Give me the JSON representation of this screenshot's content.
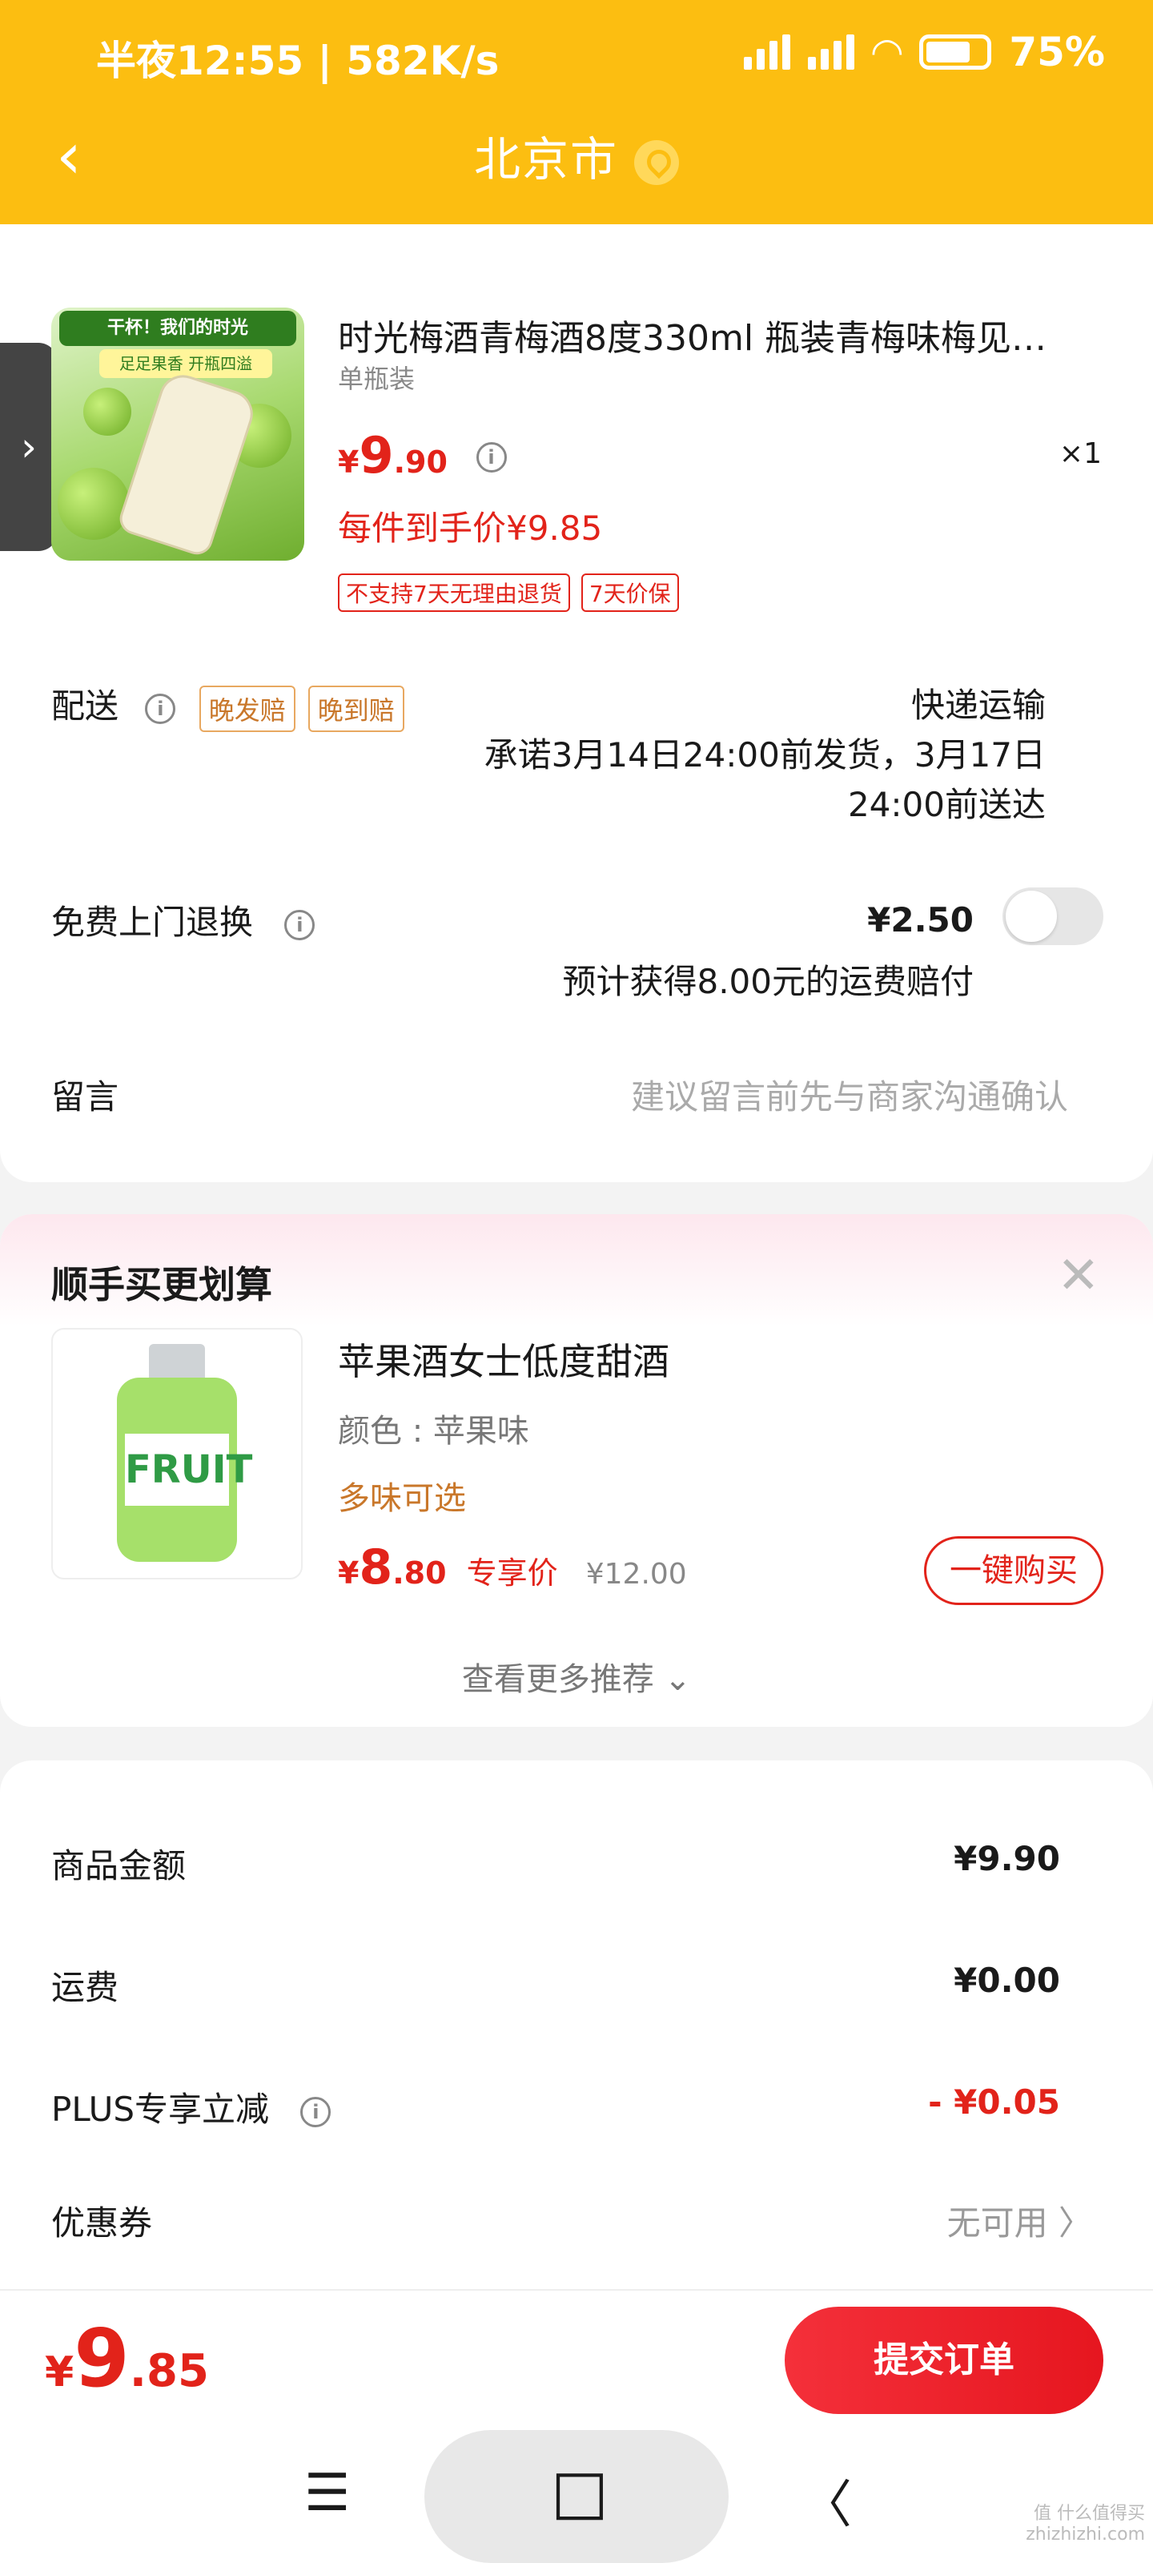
{
  "status_bar": {
    "time": "半夜12:55 | 582K/s",
    "mute_icon": "bell-off-icon",
    "battery": "75%"
  },
  "nav": {
    "back_icon": "chevron-left-icon",
    "title": "北京市",
    "location_icon": "location-pin-icon"
  },
  "product": {
    "image_text_1": "干杯！我们的时光",
    "image_text_2": "足足果香 开瓶四溢",
    "title": "时光梅酒青梅酒8度330ml 瓶装青梅味梅见…",
    "spec": "单瓶装",
    "price_symbol": "¥",
    "price_big": "9",
    "price_small": ".90",
    "quantity": "×1",
    "deal_price": "每件到手价¥9.85",
    "tags": [
      "不支持7天无理由退货",
      "7天价保"
    ]
  },
  "delivery": {
    "label": "配送",
    "tags": [
      "晚发赔",
      "晚到赔"
    ],
    "method": "快递运输",
    "promise_1": "承诺3月14日24:00前发货，3月17日",
    "promise_2": "24:00前送达"
  },
  "return_service": {
    "label": "免费上门退换",
    "price": "¥2.50",
    "note": "预计获得8.00元的运费赔付",
    "toggle_on": false
  },
  "message": {
    "label": "留言",
    "placeholder": "建议留言前先与商家沟通确认"
  },
  "recommend": {
    "title": "顺手买更划算",
    "close_icon": "close-icon",
    "item": {
      "image_text": "FRUIT",
      "title": "苹果酒女士低度甜酒",
      "color": "颜色 : 苹果味",
      "option": "多味可选",
      "price_symbol": "¥",
      "price_big": "8",
      "price_small": ".80",
      "price_tag": "专享价",
      "orig_price": "¥12.00",
      "buy_label": "一键购买"
    },
    "more_label": "查看更多推荐 ⌄"
  },
  "summary": {
    "rows": [
      {
        "label": "商品金额",
        "value": "¥9.90"
      },
      {
        "label": "运费",
        "value": "¥0.00"
      },
      {
        "label": "PLUS专享立减",
        "value": "- ¥0.05"
      },
      {
        "label": "优惠券",
        "value": "无可用 〉"
      }
    ]
  },
  "footer": {
    "total_symbol": "¥",
    "total_big": "9",
    "total_small": ".85",
    "submit_label": "提交订单"
  },
  "system_nav": {
    "menu_icon": "menu-icon",
    "home_icon": "home-square-icon",
    "back_icon": "back-icon",
    "menu_glyph": "☰",
    "home_glyph": "□",
    "back_glyph": "〈"
  },
  "watermark": "值 什么值得买 zhizhizhi.com",
  "colors": {
    "header": "#FCBE11",
    "accent_red": "#e2231a",
    "tag_orange": "#c9772a"
  }
}
